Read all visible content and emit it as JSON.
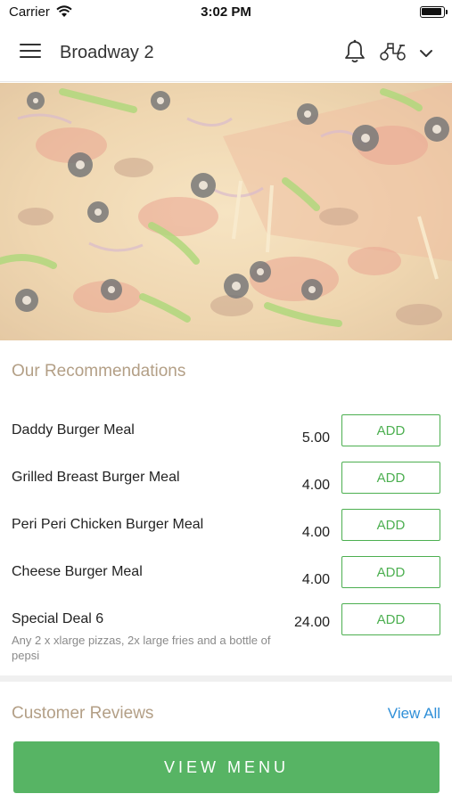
{
  "status_bar": {
    "carrier": "Carrier",
    "time": "3:02 PM"
  },
  "header": {
    "title": "Broadway 2"
  },
  "icons": {
    "menu": "hamburger-menu-icon",
    "notifications": "bell-icon",
    "delivery": "scooter-icon",
    "dropdown": "chevron-down-icon"
  },
  "recommendations": {
    "title": "Our Recommendations",
    "items": [
      {
        "name": "Daddy Burger Meal",
        "price": "5.00",
        "button": "ADD",
        "description": ""
      },
      {
        "name": "Grilled Breast Burger Meal",
        "price": "4.00",
        "button": "ADD",
        "description": ""
      },
      {
        "name": "Peri Peri Chicken Burger Meal",
        "price": "4.00",
        "button": "ADD",
        "description": ""
      },
      {
        "name": "Cheese Burger Meal",
        "price": "4.00",
        "button": "ADD",
        "description": ""
      },
      {
        "name": "Special Deal 6",
        "price": "24.00",
        "button": "ADD",
        "description": "Any 2 x xlarge pizzas, 2x large fries and a bottle of pepsi"
      }
    ]
  },
  "reviews": {
    "title": "Customer Reviews",
    "view_all": "View All"
  },
  "footer": {
    "view_menu": "VIEW MENU"
  },
  "colors": {
    "accent_green": "#57b464",
    "title_tan": "#b39f86",
    "link_blue": "#2f8fd8"
  }
}
